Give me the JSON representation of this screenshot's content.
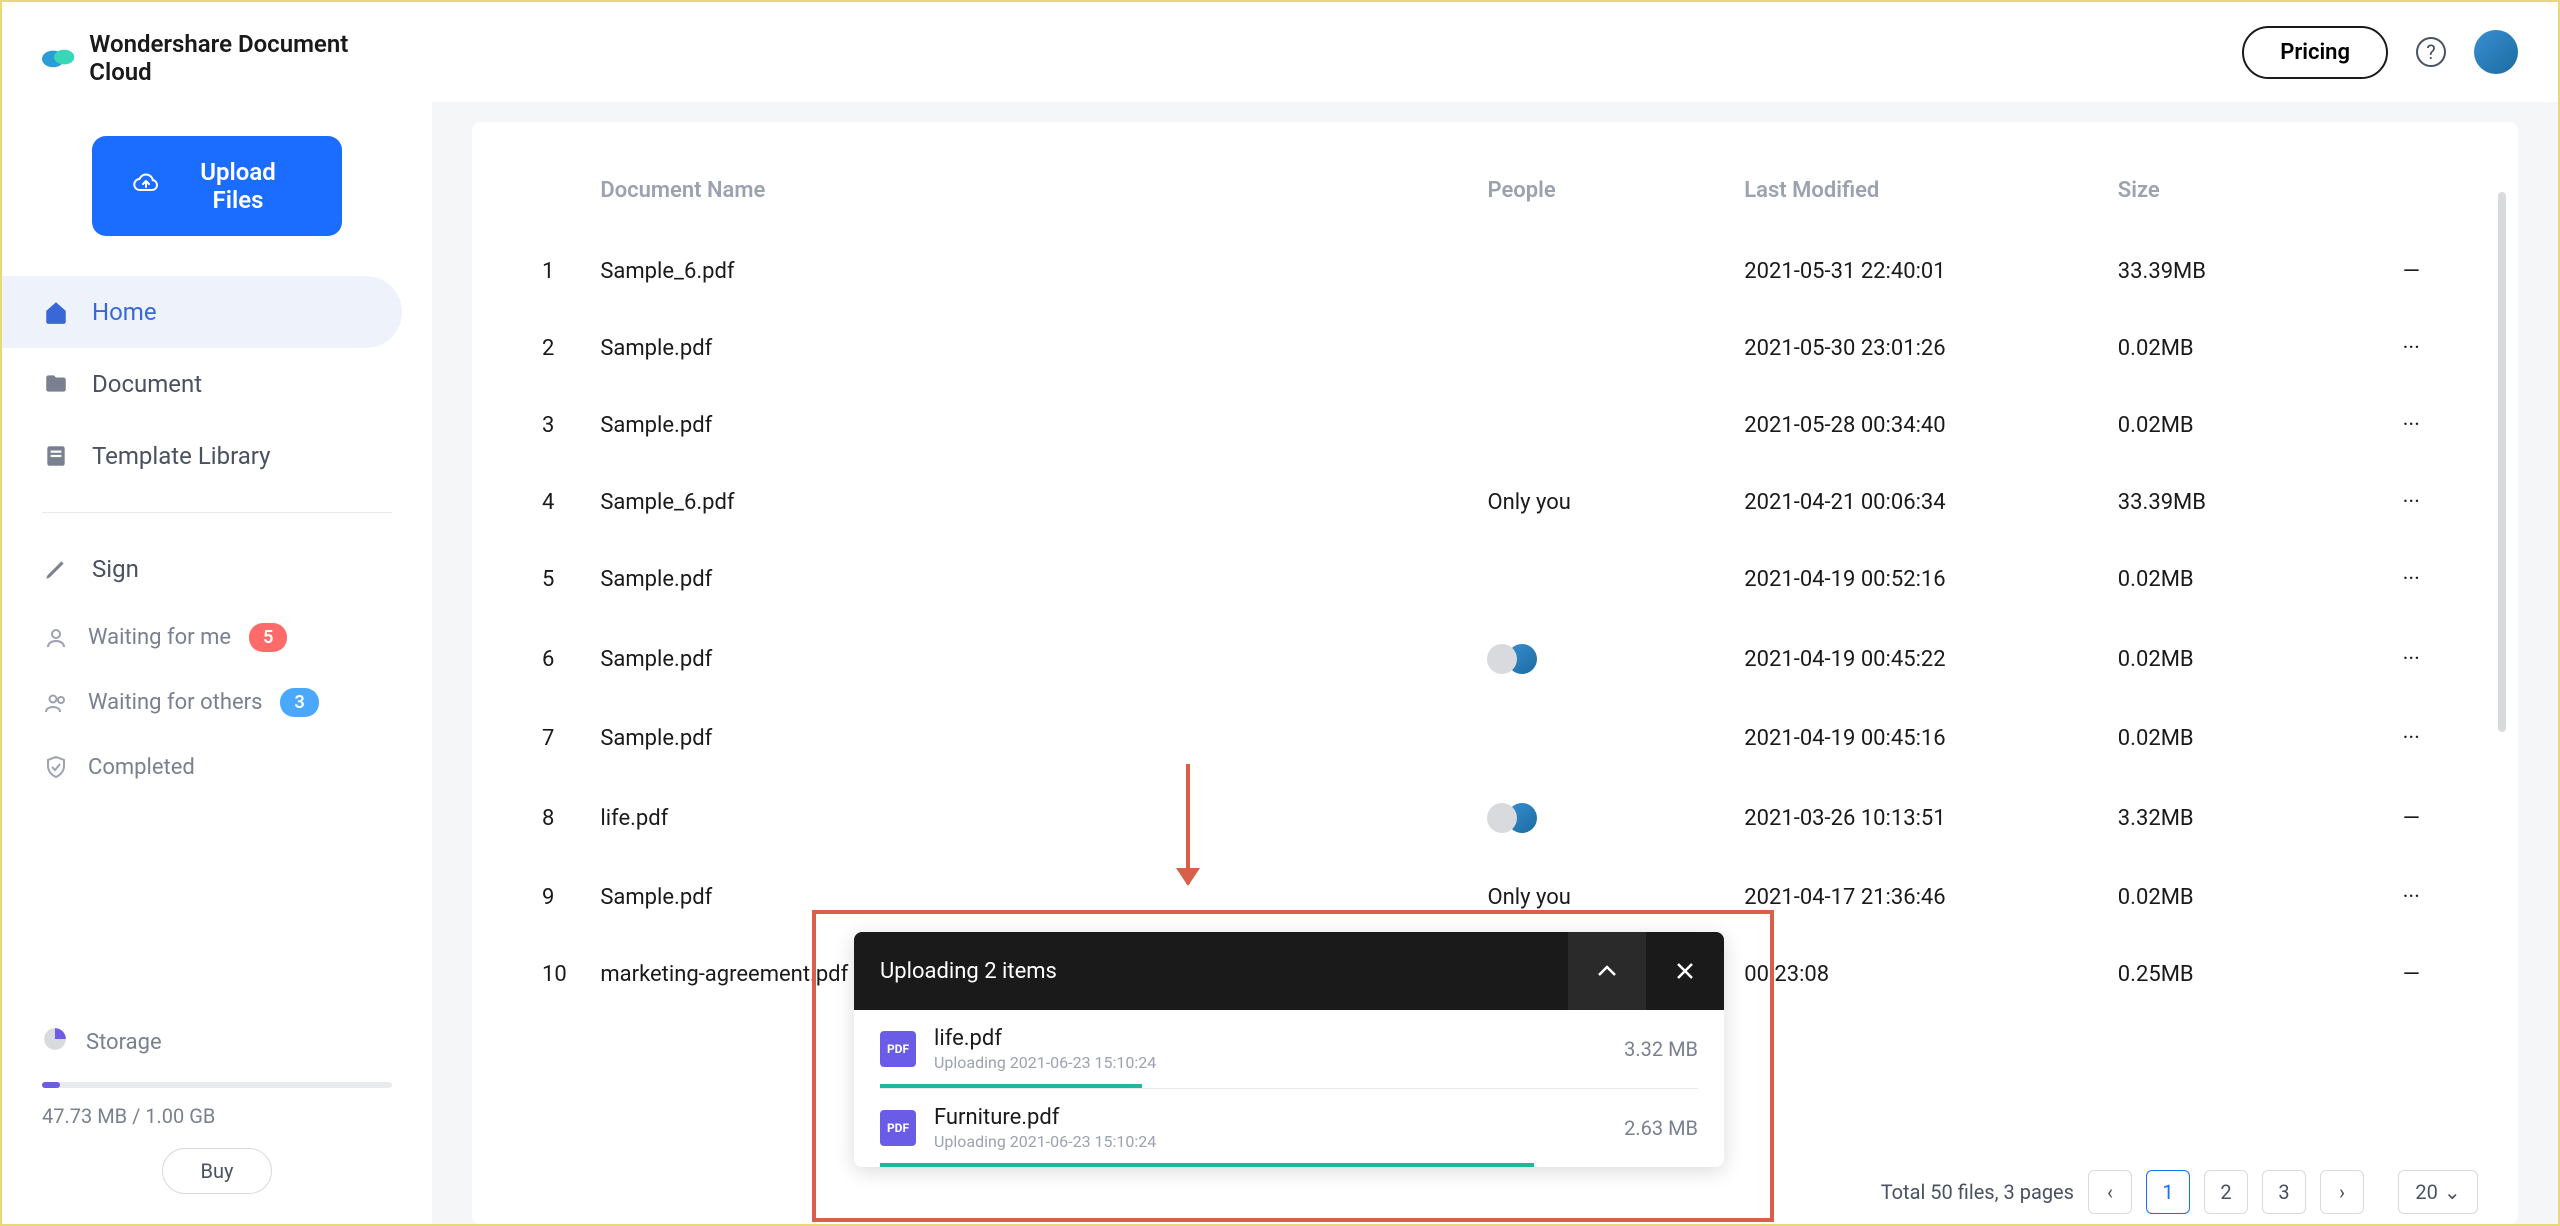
{
  "brand": {
    "name": "Wondershare Document Cloud"
  },
  "sidebar": {
    "upload_label": "Upload Files",
    "nav": [
      {
        "label": "Home",
        "icon": "home"
      },
      {
        "label": "Document",
        "icon": "doc"
      },
      {
        "label": "Template Library",
        "icon": "template"
      }
    ],
    "sign_label": "Sign",
    "sub": [
      {
        "label": "Waiting for me",
        "badge": "5",
        "badge_color": "red"
      },
      {
        "label": "Waiting for others",
        "badge": "3",
        "badge_color": "blue"
      },
      {
        "label": "Completed"
      }
    ],
    "storage": {
      "label": "Storage",
      "text": "47.73 MB / 1.00 GB",
      "buy": "Buy"
    }
  },
  "topbar": {
    "pricing": "Pricing"
  },
  "table": {
    "headers": {
      "name": "Document Name",
      "people": "People",
      "modified": "Last Modified",
      "size": "Size"
    },
    "rows": [
      {
        "idx": "1",
        "name": "Sample_6.pdf",
        "people_type": "none",
        "modified": "2021-05-31 22:40:01",
        "size": "33.39MB",
        "actions": "—"
      },
      {
        "idx": "2",
        "name": "Sample.pdf",
        "people_type": "avatar",
        "modified": "2021-05-30 23:01:26",
        "size": "0.02MB",
        "actions": "···"
      },
      {
        "idx": "3",
        "name": "Sample.pdf",
        "people_type": "avatar",
        "modified": "2021-05-28 00:34:40",
        "size": "0.02MB",
        "actions": "···"
      },
      {
        "idx": "4",
        "name": "Sample_6.pdf",
        "people_type": "text",
        "people_text": "Only you",
        "modified": "2021-04-21 00:06:34",
        "size": "33.39MB",
        "actions": "···"
      },
      {
        "idx": "5",
        "name": "Sample.pdf",
        "people_type": "avatar",
        "modified": "2021-04-19 00:52:16",
        "size": "0.02MB",
        "actions": "···"
      },
      {
        "idx": "6",
        "name": "Sample.pdf",
        "people_type": "dual",
        "modified": "2021-04-19 00:45:22",
        "size": "0.02MB",
        "actions": "···"
      },
      {
        "idx": "7",
        "name": "Sample.pdf",
        "people_type": "avatar",
        "modified": "2021-04-19 00:45:16",
        "size": "0.02MB",
        "actions": "···"
      },
      {
        "idx": "8",
        "name": "life.pdf",
        "people_type": "dual",
        "modified": "2021-03-26 10:13:51",
        "size": "3.32MB",
        "actions": "—"
      },
      {
        "idx": "9",
        "name": "Sample.pdf",
        "people_type": "text",
        "people_text": "Only you",
        "modified": "2021-04-17 21:36:46",
        "size": "0.02MB",
        "actions": "···"
      },
      {
        "idx": "10",
        "name": "marketing-agreement.pdf",
        "people_type": "none",
        "modified": "00:23:08",
        "size": "0.25MB",
        "actions": "—"
      }
    ]
  },
  "pagination": {
    "summary": "Total 50 files, 3 pages",
    "pages": [
      "1",
      "2",
      "3"
    ],
    "active": "1",
    "page_size": "20"
  },
  "upload_popup": {
    "title": "Uploading 2 items",
    "items": [
      {
        "name": "life.pdf",
        "sub": "Uploading 2021-06-23 15:10:24",
        "size": "3.32 MB",
        "progress": 32
      },
      {
        "name": "Furniture.pdf",
        "sub": "Uploading 2021-06-23 15:10:24",
        "size": "2.63 MB",
        "progress": 80
      }
    ]
  }
}
